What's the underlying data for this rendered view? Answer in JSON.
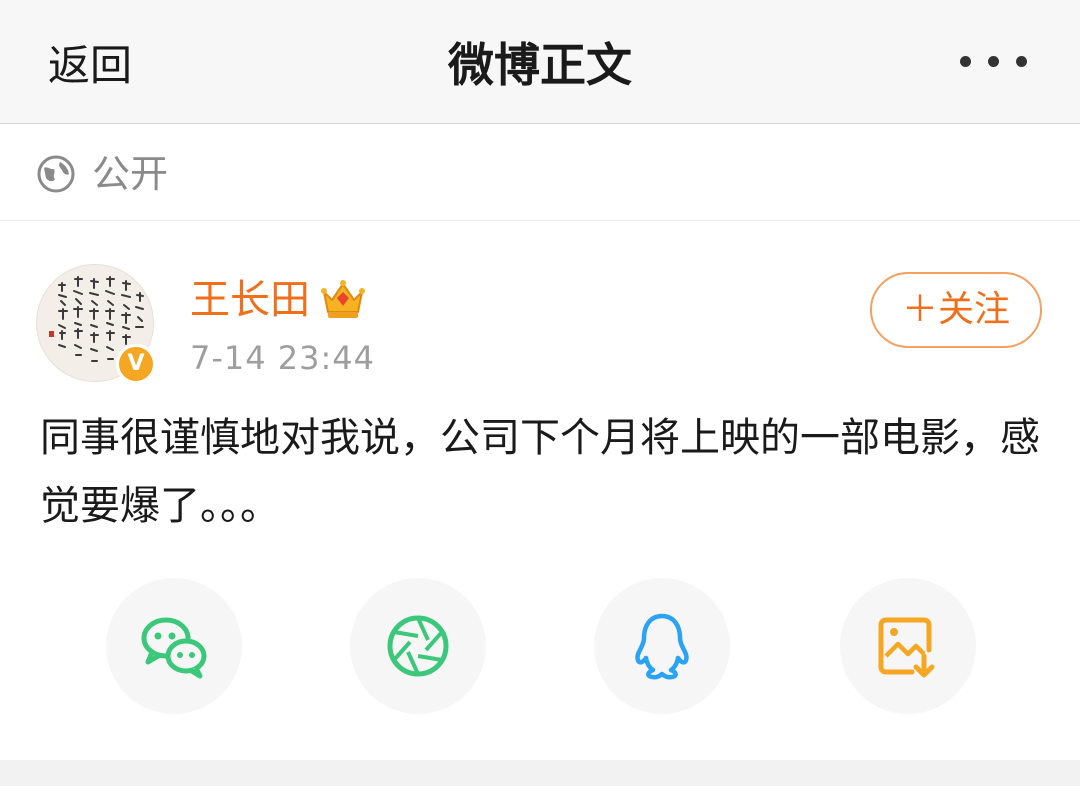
{
  "navbar": {
    "back_label": "返回",
    "title": "微博正文",
    "more_icon": "more-dots-icon"
  },
  "visibility": {
    "icon": "globe-icon",
    "label": "公开"
  },
  "post": {
    "author": {
      "name": "王长田",
      "avatar": "calligraphy-avatar",
      "verified_icon": "verified-v-icon",
      "verified_mark": "V",
      "member_icon": "crown-icon"
    },
    "time": "7-14 23:44",
    "follow_label": "＋关注",
    "text": "同事很谨慎地对我说，公司下个月将上映的一部电影，感觉要爆了。。。"
  },
  "share": [
    {
      "icon": "wechat-icon",
      "color": "#3cc87a"
    },
    {
      "icon": "moments-icon",
      "color": "#3cc87a"
    },
    {
      "icon": "qq-icon",
      "color": "#2aa3f5"
    },
    {
      "icon": "save-image-icon",
      "color": "#f5a623"
    }
  ],
  "colors": {
    "accent": "#f06f1a",
    "follow_border": "#f3a060",
    "secondary_text": "#9e9e9e"
  }
}
